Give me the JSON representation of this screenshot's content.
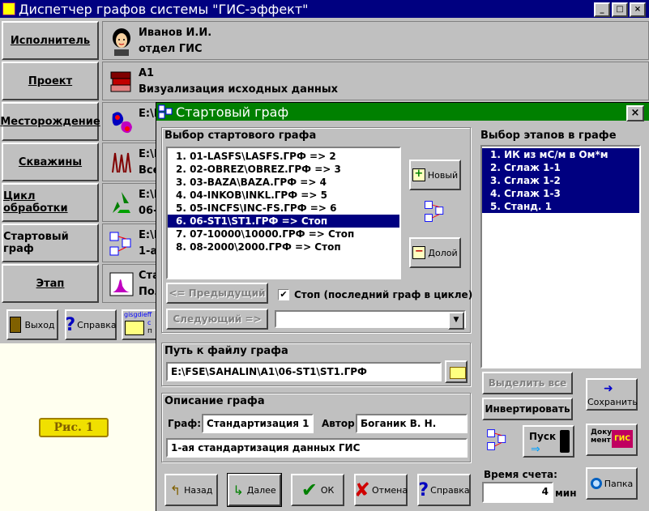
{
  "main_window": {
    "title": "Диспетчер графов системы \"ГИС-эффект\"",
    "controls": [
      "_",
      "□",
      "×"
    ]
  },
  "nav": [
    {
      "label": "Исполнитель",
      "line1": "Иванов И.И.",
      "line2": "отдел ГИС",
      "icon": "person-icon"
    },
    {
      "label": "Проект",
      "line1": "А1",
      "line2": "Визуализация исходных данных",
      "icon": "books-icon"
    },
    {
      "label": "Месторождение",
      "line1": "E:\\F",
      "line2": "",
      "icon": "field-map-icon"
    },
    {
      "label": "Скважины",
      "line1": "E:\\F",
      "line2": "Все",
      "icon": "wells-icon"
    },
    {
      "label": "Цикл обработки",
      "line1": "E:\\F",
      "line2": "06-",
      "icon": "recycle-icon"
    },
    {
      "label": "Стартовый граф",
      "line1": "E:\\F",
      "line2": "1-ая",
      "icon": "graph-icon"
    },
    {
      "label": "Этап",
      "line1": "Ста",
      "line2": "Пол",
      "icon": "chart-icon"
    }
  ],
  "bottom_buttons": {
    "exit": "Выход",
    "help": "Справка",
    "gisgdief_line1": "gisgdieff",
    "gisgdief_line2": "с",
    "gisgdief_line3": "п"
  },
  "fig_label": "Рис. 1",
  "dialog": {
    "title": "Стартовый граф",
    "close": "×",
    "select_graph_label": "Выбор стартового графа",
    "graphs": [
      "1. 01-LASFS\\LASFS.ГРФ => 2",
      "2. 02-OBREZ\\OBREZ.ГРФ => 3",
      "3. 03-BAZA\\BAZA.ГРФ => 4",
      "4. 04-INKOB\\INKL.ГРФ => 5",
      "5. 05-INCFS\\INC-FS.ГРФ => 6",
      "6. 06-ST1\\ST1.ГРФ => Стоп",
      "7. 07-10000\\10000.ГРФ => Стоп",
      "8. 08-2000\\2000.ГРФ => Стоп"
    ],
    "selected_index": 5,
    "new_button": "Новый",
    "delete_button": "Долой",
    "prev_button": "<= Предыдущий",
    "next_button": "Следующий =>",
    "stop_checkbox": "Стоп (последний граф в цикле)",
    "stop_checked": "✔",
    "path_label": "Путь к файлу графа",
    "path_value": "E:\\FSE\\SAHALIN\\A1\\06-ST1\\ST1.ГРФ",
    "desc_label": "Описание графа",
    "graph_field_label": "Граф:",
    "graph_field_value": "Стандартизация 1",
    "author_label": "Автор:",
    "author_value": "Боганик В. Н.",
    "description_value": "1-ая стандартизация данных ГИС",
    "stages_label": "Выбор этапов в графе",
    "stages": [
      "1. ИК из мС/м в Ом*м",
      "2. Сглаж 1-1",
      "3. Сглаж 1-2",
      "4. Сглаж 1-3",
      "5. Станд. 1"
    ],
    "select_all": "Выделить все",
    "invert": "Инвертировать",
    "save": "Сохранить",
    "run": "Пуск",
    "document_line1": "Доку-",
    "document_line2": "мент",
    "document_logo": "ГИС",
    "time_label": "Время счета:",
    "time_value": "4",
    "time_unit": "мин",
    "folder": "Папка",
    "back": "Назад",
    "forward": "Далее",
    "ok": "ОК",
    "cancel": "Отмена",
    "help": "Справка"
  }
}
